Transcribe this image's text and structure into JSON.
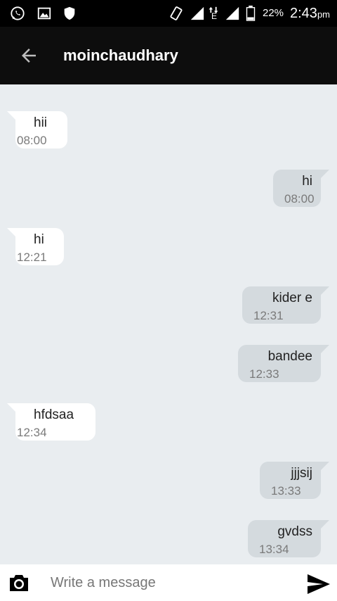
{
  "status_bar": {
    "icons": [
      "whatsapp-icon",
      "image-icon",
      "shield-icon",
      "vibrate-icon",
      "signal-icon",
      "data-arrows-icon",
      "battery-icon"
    ],
    "network": "E",
    "battery": "22%",
    "time": "2:43",
    "time_suffix": "pm"
  },
  "app_bar": {
    "back_icon": "arrow-back-icon",
    "title": "moinchaudhary"
  },
  "messages": [
    {
      "direction": "in",
      "text": "hii",
      "time": "08:00"
    },
    {
      "direction": "out",
      "text": "hi",
      "time": "08:00"
    },
    {
      "direction": "in",
      "text": "hi",
      "time": "12:21"
    },
    {
      "direction": "out",
      "text": "kider e",
      "time": "12:31"
    },
    {
      "direction": "out",
      "text": "bandee",
      "time": "12:33"
    },
    {
      "direction": "in",
      "text": "hfdsaa",
      "time": "12:34"
    },
    {
      "direction": "out",
      "text": "jjjsij",
      "time": "13:33"
    },
    {
      "direction": "out",
      "text": "gvdss",
      "time": "13:34"
    }
  ],
  "composer": {
    "camera_icon": "camera-icon",
    "placeholder": "Write a message",
    "value": "",
    "send_icon": "send-icon"
  },
  "colors": {
    "background": "#e9edf0",
    "incoming_bubble": "#ffffff",
    "outgoing_bubble": "#d4dade",
    "app_bar": "#0d0d0d"
  }
}
